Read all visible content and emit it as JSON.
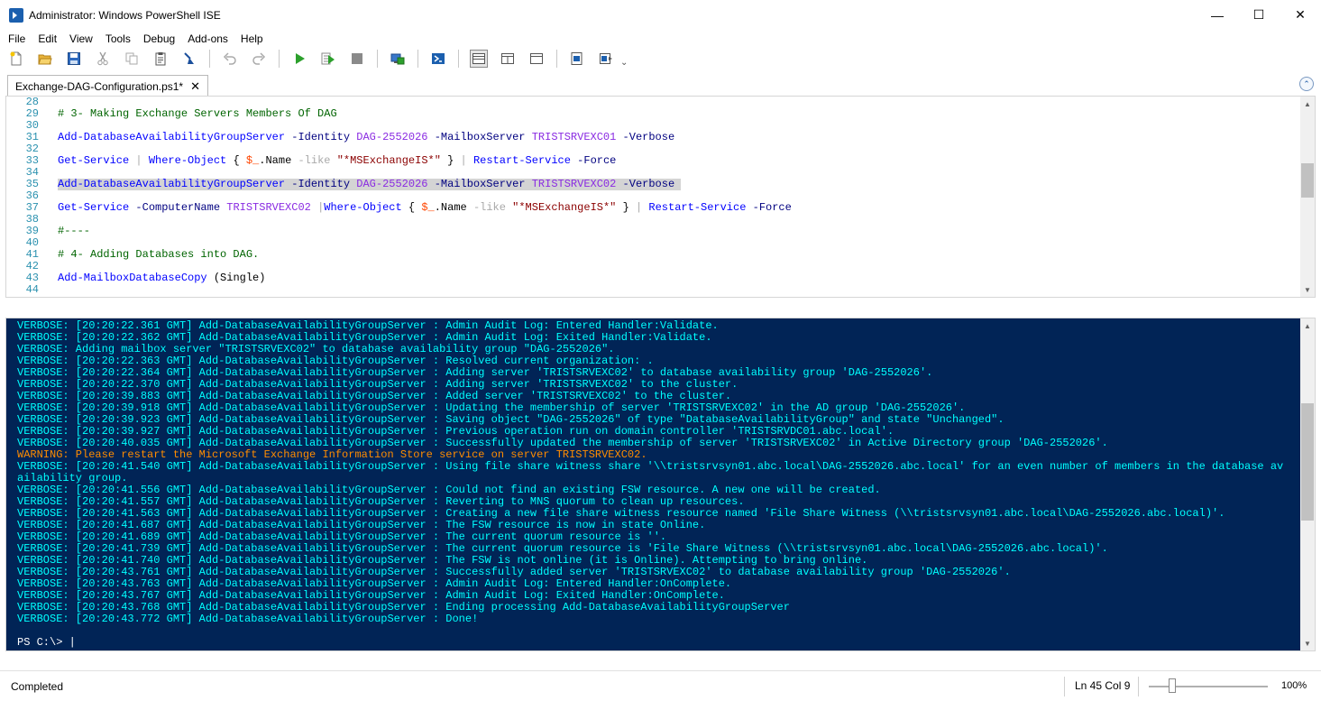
{
  "window": {
    "title": "Administrator: Windows PowerShell ISE",
    "minimize": "—",
    "maximize": "☐",
    "close": "✕"
  },
  "menu": [
    "File",
    "Edit",
    "View",
    "Tools",
    "Debug",
    "Add-ons",
    "Help"
  ],
  "toolbar": {
    "buttons": [
      "new-script",
      "open",
      "save",
      "cut",
      "copy",
      "paste",
      "clear-console",
      "undo",
      "redo",
      "run-script",
      "run-selection",
      "stop",
      "new-remote-tab",
      "start-powershell",
      "show-script-top",
      "show-script-right",
      "show-script-maximized",
      "show-command-window",
      "show-command-addon",
      "customize"
    ],
    "overflow": "⌄"
  },
  "tabs": [
    {
      "label": "Exchange-DAG-Configuration.ps1*",
      "close": "✕"
    }
  ],
  "collapse_glyph": "⌃",
  "editor": {
    "lines": [
      {
        "n": "28",
        "tokens": []
      },
      {
        "n": "29",
        "tokens": [
          [
            "c-com",
            "# 3- Making Exchange Servers Members Of DAG"
          ]
        ]
      },
      {
        "n": "30",
        "tokens": []
      },
      {
        "n": "31",
        "tokens": [
          [
            "c-cmd",
            "Add-DatabaseAvailabilityGroupServer"
          ],
          [
            "c-plain",
            " "
          ],
          [
            "c-param",
            "-Identity"
          ],
          [
            "c-plain",
            " "
          ],
          [
            "c-str",
            "DAG-2552026"
          ],
          [
            "c-plain",
            " "
          ],
          [
            "c-param",
            "-MailboxServer"
          ],
          [
            "c-plain",
            " "
          ],
          [
            "c-str",
            "TRISTSRVEXC01"
          ],
          [
            "c-plain",
            " "
          ],
          [
            "c-param",
            "-Verbose"
          ]
        ]
      },
      {
        "n": "32",
        "tokens": []
      },
      {
        "n": "33",
        "tokens": [
          [
            "c-cmd",
            "Get-Service"
          ],
          [
            "c-plain",
            " "
          ],
          [
            "c-op",
            "|"
          ],
          [
            "c-plain",
            " "
          ],
          [
            "c-cmd",
            "Where-Object"
          ],
          [
            "c-plain",
            " { "
          ],
          [
            "c-var",
            "$_"
          ],
          [
            "c-plain",
            ".Name "
          ],
          [
            "c-op",
            "-like"
          ],
          [
            "c-plain",
            " "
          ],
          [
            "c-qstr",
            "\"*MSExchangeIS*\""
          ],
          [
            "c-plain",
            " } "
          ],
          [
            "c-op",
            "|"
          ],
          [
            "c-plain",
            " "
          ],
          [
            "c-cmd",
            "Restart-Service"
          ],
          [
            "c-plain",
            " "
          ],
          [
            "c-param",
            "-Force"
          ]
        ]
      },
      {
        "n": "34",
        "tokens": []
      },
      {
        "n": "35",
        "hl": true,
        "tokens": [
          [
            "c-cmd",
            "Add-DatabaseAvailabilityGroupServer"
          ],
          [
            "c-plain",
            " "
          ],
          [
            "c-param",
            "-Identity"
          ],
          [
            "c-plain",
            " "
          ],
          [
            "c-str",
            "DAG-2552026"
          ],
          [
            "c-plain",
            " "
          ],
          [
            "c-param",
            "-MailboxServer"
          ],
          [
            "c-plain",
            " "
          ],
          [
            "c-str",
            "TRISTSRVEXC02"
          ],
          [
            "c-plain",
            " "
          ],
          [
            "c-param",
            "-Verbose"
          ],
          [
            "c-plain",
            " "
          ]
        ]
      },
      {
        "n": "36",
        "tokens": []
      },
      {
        "n": "37",
        "tokens": [
          [
            "c-cmd",
            "Get-Service"
          ],
          [
            "c-plain",
            " "
          ],
          [
            "c-param",
            "-ComputerName"
          ],
          [
            "c-plain",
            " "
          ],
          [
            "c-str",
            "TRISTSRVEXC02"
          ],
          [
            "c-plain",
            " "
          ],
          [
            "c-op",
            "|"
          ],
          [
            "c-cmd",
            "Where-Object"
          ],
          [
            "c-plain",
            " { "
          ],
          [
            "c-var",
            "$_"
          ],
          [
            "c-plain",
            ".Name "
          ],
          [
            "c-op",
            "-like"
          ],
          [
            "c-plain",
            " "
          ],
          [
            "c-qstr",
            "\"*MSExchangeIS*\""
          ],
          [
            "c-plain",
            " } "
          ],
          [
            "c-op",
            "|"
          ],
          [
            "c-plain",
            " "
          ],
          [
            "c-cmd",
            "Restart-Service"
          ],
          [
            "c-plain",
            " "
          ],
          [
            "c-param",
            "-Force"
          ]
        ]
      },
      {
        "n": "38",
        "tokens": []
      },
      {
        "n": "39",
        "tokens": [
          [
            "c-com",
            "#----"
          ]
        ]
      },
      {
        "n": "40",
        "tokens": []
      },
      {
        "n": "41",
        "tokens": [
          [
            "c-com",
            "# 4- Adding Databases into DAG."
          ]
        ]
      },
      {
        "n": "42",
        "tokens": []
      },
      {
        "n": "43",
        "tokens": [
          [
            "c-cmd",
            "Add-MailboxDatabaseCopy"
          ],
          [
            "c-plain",
            " (Single)"
          ]
        ]
      },
      {
        "n": "44",
        "tokens": []
      }
    ]
  },
  "console": {
    "lines": [
      {
        "t": "VERBOSE: [20:20:22.361 GMT] Add-DatabaseAvailabilityGroupServer : Admin Audit Log: Entered Handler:Validate."
      },
      {
        "t": "VERBOSE: [20:20:22.362 GMT] Add-DatabaseAvailabilityGroupServer : Admin Audit Log: Exited Handler:Validate."
      },
      {
        "t": "VERBOSE: Adding mailbox server \"TRISTSRVEXC02\" to database availability group \"DAG-2552026\"."
      },
      {
        "t": "VERBOSE: [20:20:22.363 GMT] Add-DatabaseAvailabilityGroupServer : Resolved current organization: ."
      },
      {
        "t": "VERBOSE: [20:20:22.364 GMT] Add-DatabaseAvailabilityGroupServer : Adding server 'TRISTSRVEXC02' to database availability group 'DAG-2552026'."
      },
      {
        "t": "VERBOSE: [20:20:22.370 GMT] Add-DatabaseAvailabilityGroupServer : Adding server 'TRISTSRVEXC02' to the cluster."
      },
      {
        "t": "VERBOSE: [20:20:39.883 GMT] Add-DatabaseAvailabilityGroupServer : Added server 'TRISTSRVEXC02' to the cluster."
      },
      {
        "t": "VERBOSE: [20:20:39.918 GMT] Add-DatabaseAvailabilityGroupServer : Updating the membership of server 'TRISTSRVEXC02' in the AD group 'DAG-2552026'."
      },
      {
        "t": "VERBOSE: [20:20:39.923 GMT] Add-DatabaseAvailabilityGroupServer : Saving object \"DAG-2552026\" of type \"DatabaseAvailabilityGroup\" and state \"Unchanged\"."
      },
      {
        "t": "VERBOSE: [20:20:39.927 GMT] Add-DatabaseAvailabilityGroupServer : Previous operation run on domain controller 'TRISTSRVDC01.abc.local'."
      },
      {
        "t": "VERBOSE: [20:20:40.035 GMT] Add-DatabaseAvailabilityGroupServer : Successfully updated the membership of server 'TRISTSRVEXC02' in Active Directory group 'DAG-2552026'."
      },
      {
        "t": "WARNING: Please restart the Microsoft Exchange Information Store service on server TRISTSRVEXC02.",
        "warn": true
      },
      {
        "t": "VERBOSE: [20:20:41.540 GMT] Add-DatabaseAvailabilityGroupServer : Using file share witness share '\\\\tristsrvsyn01.abc.local\\DAG-2552026.abc.local' for an even number of members in the database av"
      },
      {
        "t": "ailability group."
      },
      {
        "t": "VERBOSE: [20:20:41.556 GMT] Add-DatabaseAvailabilityGroupServer : Could not find an existing FSW resource. A new one will be created."
      },
      {
        "t": "VERBOSE: [20:20:41.557 GMT] Add-DatabaseAvailabilityGroupServer : Reverting to MNS quorum to clean up resources."
      },
      {
        "t": "VERBOSE: [20:20:41.563 GMT] Add-DatabaseAvailabilityGroupServer : Creating a new file share witness resource named 'File Share Witness (\\\\tristsrvsyn01.abc.local\\DAG-2552026.abc.local)'."
      },
      {
        "t": "VERBOSE: [20:20:41.687 GMT] Add-DatabaseAvailabilityGroupServer : The FSW resource is now in state Online."
      },
      {
        "t": "VERBOSE: [20:20:41.689 GMT] Add-DatabaseAvailabilityGroupServer : The current quorum resource is ''."
      },
      {
        "t": "VERBOSE: [20:20:41.739 GMT] Add-DatabaseAvailabilityGroupServer : The current quorum resource is 'File Share Witness (\\\\tristsrvsyn01.abc.local\\DAG-2552026.abc.local)'."
      },
      {
        "t": "VERBOSE: [20:20:41.740 GMT] Add-DatabaseAvailabilityGroupServer : The FSW is not online (it is Online). Attempting to bring online."
      },
      {
        "t": "VERBOSE: [20:20:43.761 GMT] Add-DatabaseAvailabilityGroupServer : Successfully added server 'TRISTSRVEXC02' to database availability group 'DAG-2552026'."
      },
      {
        "t": "VERBOSE: [20:20:43.763 GMT] Add-DatabaseAvailabilityGroupServer : Admin Audit Log: Entered Handler:OnComplete."
      },
      {
        "t": "VERBOSE: [20:20:43.767 GMT] Add-DatabaseAvailabilityGroupServer : Admin Audit Log: Exited Handler:OnComplete."
      },
      {
        "t": "VERBOSE: [20:20:43.768 GMT] Add-DatabaseAvailabilityGroupServer : Ending processing Add-DatabaseAvailabilityGroupServer"
      },
      {
        "t": "VERBOSE: [20:20:43.772 GMT] Add-DatabaseAvailabilityGroupServer : Done!"
      }
    ],
    "prompt": "PS C:\\> |"
  },
  "status": {
    "text": "Completed",
    "position": "Ln 45  Col 9",
    "zoom": "100%",
    "zoom_level": 0.2
  },
  "colors": {
    "console_bg": "#012456",
    "verbose": "#00ffff",
    "warning": "#ff8c00"
  }
}
